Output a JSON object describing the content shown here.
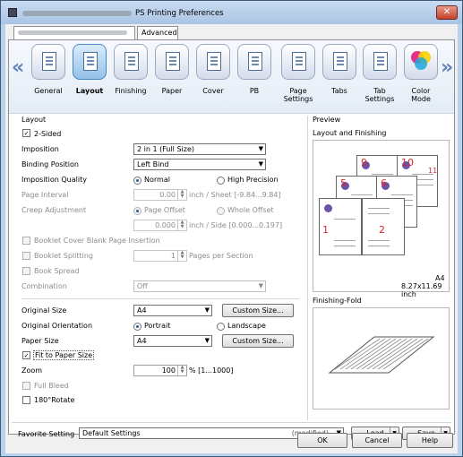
{
  "window": {
    "title": "PS Printing Preferences",
    "close_glyph": "✕"
  },
  "tabs": [
    {
      "label": ""
    },
    {
      "label": "Advanced"
    }
  ],
  "nav": {
    "prev_glyph": "«",
    "next_glyph": "»"
  },
  "categories": [
    {
      "label": "General",
      "icon": "general-icon"
    },
    {
      "label": "Layout",
      "icon": "layout-icon",
      "active": true
    },
    {
      "label": "Finishing",
      "icon": "finishing-icon"
    },
    {
      "label": "Paper",
      "icon": "paper-icon"
    },
    {
      "label": "Cover",
      "icon": "cover-icon"
    },
    {
      "label": "PB",
      "icon": "perfect-binding-icon"
    },
    {
      "label": "Page Settings",
      "icon": "page-settings-icon"
    },
    {
      "label": "Tabs",
      "icon": "tabs-icon"
    },
    {
      "label": "Tab Settings",
      "icon": "tab-settings-icon"
    },
    {
      "label": "Color Mode",
      "icon": "color-mode-icon"
    }
  ],
  "layout": {
    "group_title": "Layout",
    "two_sided": {
      "label": "2-Sided",
      "checked": true
    },
    "imposition": {
      "label": "Imposition",
      "value": "2 in 1 (Full Size)"
    },
    "binding_position": {
      "label": "Binding Position",
      "value": "Left Bind"
    },
    "imposition_quality": {
      "label": "Imposition Quality",
      "normal": "Normal",
      "high": "High Precision"
    },
    "page_interval": {
      "label": "Page Interval",
      "value": "0.00",
      "unit": "inch / Sheet [-9.84...9.84]"
    },
    "creep_adjustment": {
      "label": "Creep Adjustment",
      "page_offset": "Page Offset",
      "whole_offset": "Whole Offset",
      "value": "0.000",
      "unit": "inch / Side [0.000...0.197]"
    },
    "booklet_cover": "Booklet Cover Blank Page Insertion",
    "booklet_splitting": {
      "label": "Booklet Splitting",
      "value": "1",
      "unit": "Pages per Section"
    },
    "book_spread": "Book Spread",
    "combination": {
      "label": "Combination",
      "value": "Off"
    },
    "original_size": {
      "label": "Original Size",
      "value": "A4",
      "button": "Custom Size..."
    },
    "original_orientation": {
      "label": "Original Orientation",
      "portrait": "Portrait",
      "landscape": "Landscape"
    },
    "paper_size": {
      "label": "Paper Size",
      "value": "A4",
      "button": "Custom Size..."
    },
    "fit_to_paper": {
      "label": "Fit to Paper Size",
      "checked": true
    },
    "zoom": {
      "label": "Zoom",
      "value": "100",
      "unit": "% [1...1000]"
    },
    "full_bleed": "Full Bleed",
    "rotate": "180°Rotate"
  },
  "preview": {
    "title": "Preview",
    "subtitle": "Layout and Finishing",
    "paper_label": "A4",
    "paper_dims": "8.27x11.69 inch",
    "finishing_fold": "Finishing-Fold",
    "page_numbers": [
      "1",
      "2",
      "5",
      "6",
      "9",
      "10",
      "11"
    ]
  },
  "footer": {
    "favorite_label": "Favorite Setting",
    "favorite_value": "Default Settings",
    "modified": "(modified)",
    "load": "Load",
    "save": "Save"
  },
  "buttons": {
    "ok": "OK",
    "cancel": "Cancel",
    "help": "Help"
  },
  "colors": {
    "accent": "#1b5ea8",
    "number_red": "#d9272e"
  }
}
